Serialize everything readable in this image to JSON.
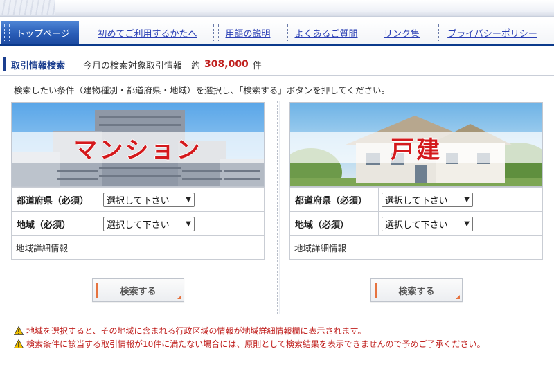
{
  "nav": {
    "items": [
      {
        "label": "トップページ",
        "active": true
      },
      {
        "label": "初めてご利用するかたへ",
        "active": false
      },
      {
        "label": "用語の説明",
        "active": false
      },
      {
        "label": "よくあるご質問",
        "active": false
      },
      {
        "label": "リンク集",
        "active": false
      },
      {
        "label": "プライバシーポリシー",
        "active": false
      }
    ]
  },
  "header": {
    "title": "取引情報検索",
    "count_label": "今月の検索対象取引情報　約",
    "count_value": "308,000",
    "count_unit": "件"
  },
  "instruction": "検索したい条件（建物種別・都道府県・地域）を選択し、「検索する」ボタンを押してください。",
  "panels": {
    "mansion": {
      "hero_label": "マンション",
      "prefecture_label": "都道府県（必須）",
      "prefecture_value": "選択して下さい",
      "region_label": "地域（必須）",
      "region_value": "選択して下さい",
      "detail_label": "地域詳細情報",
      "search_label": "検索する"
    },
    "house": {
      "hero_label": "戸建",
      "prefecture_label": "都道府県（必須）",
      "prefecture_value": "選択して下さい",
      "region_label": "地域（必須）",
      "region_value": "選択して下さい",
      "detail_label": "地域詳細情報",
      "search_label": "検索する"
    }
  },
  "notes": [
    "地域を選択すると、その地域に含まれる行政区域の情報が地域詳細情報欄に表示されます。",
    "検索条件に該当する取引情報が10件に満たない場合には、原則として検索結果を表示できませんので予めご了承ください。"
  ],
  "colors": {
    "accent": "#1c3f8f",
    "nav_active": "#2a5db7",
    "warning_text": "#c0201e",
    "hero_label": "#d4191c"
  },
  "icons": [
    "warning-icon",
    "chevron-down-icon"
  ]
}
